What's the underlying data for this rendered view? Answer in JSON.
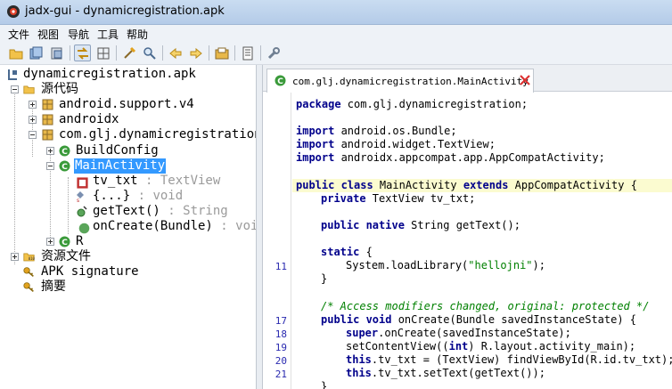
{
  "window": {
    "title": "jadx-gui - dynamicregistration.apk"
  },
  "menu": {
    "items": [
      "文件",
      "视图",
      "导航",
      "工具",
      "帮助"
    ]
  },
  "toolbar": {
    "icons": [
      "open-folder-icon",
      "save-all-icon",
      "export-icon",
      "sync-tree-icon",
      "flatten-packages-icon",
      "search-class-icon",
      "search-text-icon",
      "back-icon",
      "forward-icon",
      "decompile-all-icon",
      "log-icon",
      "preferences-icon"
    ]
  },
  "tree": {
    "root": "dynamicregistration.apk",
    "source_code": "源代码",
    "packages": [
      "android.support.v4",
      "androidx",
      "com.glj.dynamicregistration"
    ],
    "classes": [
      "BuildConfig",
      "MainActivity",
      "R"
    ],
    "members": [
      {
        "name": "tv_txt",
        "type": " : TextView"
      },
      {
        "name": "{...}",
        "type": " : void"
      },
      {
        "name": "getText()",
        "type": " : String"
      },
      {
        "name": "onCreate(Bundle)",
        "type": " : void"
      }
    ],
    "resources": "资源文件",
    "apk_signature": "APK signature",
    "summary": "摘要"
  },
  "editor": {
    "tab_label": "com.glj.dynamicregistration.MainActivity",
    "line_numbers": [
      "11",
      "17",
      "18",
      "19",
      "20",
      "21"
    ],
    "code": {
      "l1_kw": "package",
      "l1_rest": " com.glj.dynamicregistration;",
      "l3_kw": "import",
      "l3_rest": " android.os.Bundle;",
      "l4_kw": "import",
      "l4_rest": " android.widget.TextView;",
      "l5_kw": "import",
      "l5_rest": " androidx.appcompat.app.AppCompatActivity;",
      "l7_a": "public class",
      "l7_b": " MainActivity ",
      "l7_c": "extends",
      "l7_d": " AppCompatActivity {",
      "l8_a": "private",
      "l8_b": " TextView tv_txt;",
      "l10_a": "public native",
      "l10_b": " String getText();",
      "l12_a": "static",
      "l12_b": " {",
      "l13": "System.loadLibrary(",
      "l13_str": "\"hellojni\"",
      "l13_end": ");",
      "l14": "}",
      "l16_cmt": "/* Access modifiers changed, original: protected */",
      "l17_a": "public void",
      "l17_b": " onCreate(Bundle savedInstanceState) {",
      "l18_a": "super",
      "l18_b": ".onCreate(savedInstanceState);",
      "l19_a": "setContentView((",
      "l19_b": "int",
      "l19_c": ") R.layout.activity_main);",
      "l20_a": "this",
      "l20_b": ".tv_txt = (TextView) findViewById(R.id.tv_txt);",
      "l21_a": "this",
      "l21_b": ".tv_txt.setText(getText());",
      "l22": "}"
    }
  }
}
